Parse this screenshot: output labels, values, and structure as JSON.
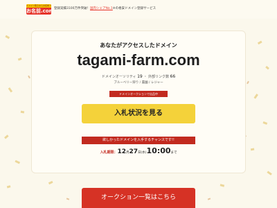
{
  "colors": {
    "brand_red": "#e6332a",
    "accent_yellow": "#f4d23a",
    "badge_red": "#c22a1f",
    "background": "#fbf8ec"
  },
  "header": {
    "logo_top_text": "ドメイン取るならお名前.com",
    "logo_main_text": "お名前.com",
    "tagline_before": "登録実績3100万件突破！",
    "tagline_link": "国内シェアNo.1",
    "tagline_after": "※の格安ドメイン登録サービス"
  },
  "main": {
    "headline": "あなたがアクセスしたドメイン",
    "domain": "tagami-farm.com",
    "authority_label": "ドメインオーソリティ",
    "authority_value": "19",
    "backlinks_label": "外部リンク数",
    "backlinks_value": "66",
    "category": "ブルーベリー狩り / 農園 / レジャー",
    "badge": "ドメインオークションで出品中",
    "bid_button": "入札状況を見る",
    "chance_banner": "欲しかったドメインを入手するチャンスです!!",
    "deadline_label": "入札期限：",
    "deadline_month": "12",
    "deadline_month_unit": "月",
    "deadline_day": "27",
    "deadline_day_unit": "日",
    "deadline_weekday": "(水)",
    "deadline_time": "10:00",
    "deadline_suffix": "まで",
    "auction_button": "オークション一覧はこちら"
  }
}
